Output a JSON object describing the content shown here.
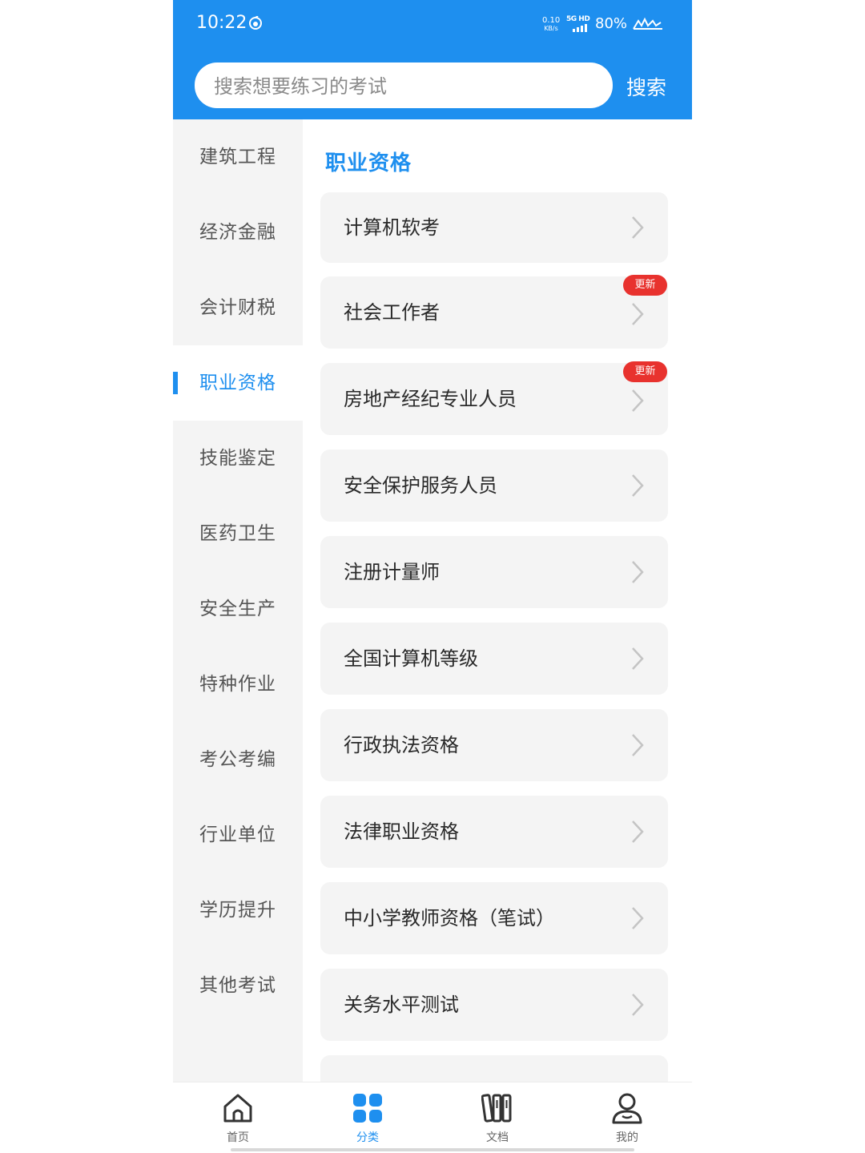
{
  "status_bar": {
    "time": "10:22",
    "net_speed": "0.10",
    "net_unit": "KB/s",
    "network": "5G HD",
    "battery": "80%"
  },
  "search": {
    "placeholder": "搜索想要练习的考试",
    "button": "搜索"
  },
  "sidebar": {
    "items": [
      {
        "label": "建筑工程",
        "active": false
      },
      {
        "label": "经济金融",
        "active": false
      },
      {
        "label": "会计财税",
        "active": false
      },
      {
        "label": "职业资格",
        "active": true
      },
      {
        "label": "技能鉴定",
        "active": false
      },
      {
        "label": "医药卫生",
        "active": false
      },
      {
        "label": "安全生产",
        "active": false
      },
      {
        "label": "特种作业",
        "active": false
      },
      {
        "label": "考公考编",
        "active": false
      },
      {
        "label": "行业单位",
        "active": false
      },
      {
        "label": "学历提升",
        "active": false
      },
      {
        "label": "其他考试",
        "active": false
      }
    ]
  },
  "content": {
    "title": "职业资格",
    "items": [
      {
        "label": "计算机软考",
        "badge": ""
      },
      {
        "label": "社会工作者",
        "badge": "更新"
      },
      {
        "label": "房地产经纪专业人员",
        "badge": "更新"
      },
      {
        "label": "安全保护服务人员",
        "badge": ""
      },
      {
        "label": "注册计量师",
        "badge": ""
      },
      {
        "label": "全国计算机等级",
        "badge": ""
      },
      {
        "label": "行政执法资格",
        "badge": ""
      },
      {
        "label": "法律职业资格",
        "badge": ""
      },
      {
        "label": "中小学教师资格（笔试）",
        "badge": ""
      },
      {
        "label": "关务水平测试",
        "badge": ""
      }
    ]
  },
  "tabbar": {
    "tabs": [
      {
        "label": "首页",
        "icon": "home-icon",
        "active": false
      },
      {
        "label": "分类",
        "icon": "category-icon",
        "active": true
      },
      {
        "label": "文档",
        "icon": "document-icon",
        "active": false
      },
      {
        "label": "我的",
        "icon": "profile-icon",
        "active": false
      }
    ]
  },
  "colors": {
    "accent": "#1e8fef",
    "badge": "#e8322e",
    "sidebar_bg": "#f4f4f4",
    "card_bg": "#f4f4f4"
  }
}
